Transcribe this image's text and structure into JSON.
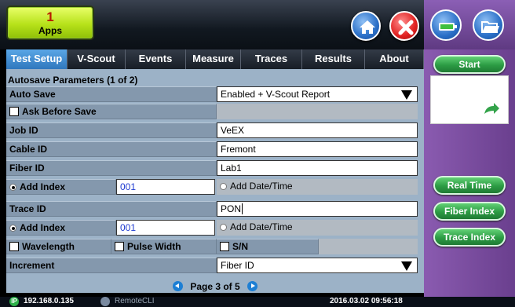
{
  "apps": {
    "count": "1",
    "label": "Apps"
  },
  "tabs": [
    "Test Setup",
    "V-Scout",
    "Events",
    "Measure",
    "Traces",
    "Results",
    "About"
  ],
  "section_title": "Autosave Parameters (1 of 2)",
  "auto_save": {
    "label": "Auto Save",
    "value": "Enabled + V-Scout Report"
  },
  "ask_before_save": {
    "label": "Ask Before Save",
    "checked": false
  },
  "job_id": {
    "label": "Job ID",
    "value": "VeEX"
  },
  "cable_id": {
    "label": "Cable ID",
    "value": "Fremont"
  },
  "fiber_id": {
    "label": "Fiber ID",
    "value": "Lab1"
  },
  "add_index_1": {
    "label": "Add Index",
    "value": "001",
    "date_label": "Add Date/Time"
  },
  "trace_id": {
    "label": "Trace ID",
    "value": "PON"
  },
  "add_index_2": {
    "label": "Add Index",
    "value": "001",
    "date_label": "Add Date/Time"
  },
  "options": {
    "wavelength": "Wavelength",
    "pulse_width": "Pulse Width",
    "sn": "S/N"
  },
  "increment": {
    "label": "Increment",
    "value": "Fiber ID"
  },
  "pager": {
    "text": "Page 3 of 5"
  },
  "right_panel": {
    "start": "Start",
    "real_time": "Real Time",
    "fiber_index": "Fiber Index",
    "trace_index": "Trace Index"
  },
  "status": {
    "ip_icon": "IP",
    "ip": "192.168.0.135",
    "remote": "RemoteCLI",
    "datetime": "2016.03.02 09:56:18"
  },
  "colors": {
    "accent_tab": "#3f8fd6",
    "start_green": "#2c9c44",
    "close_red": "#e02020",
    "panel_purple": "#7a4ea0"
  }
}
